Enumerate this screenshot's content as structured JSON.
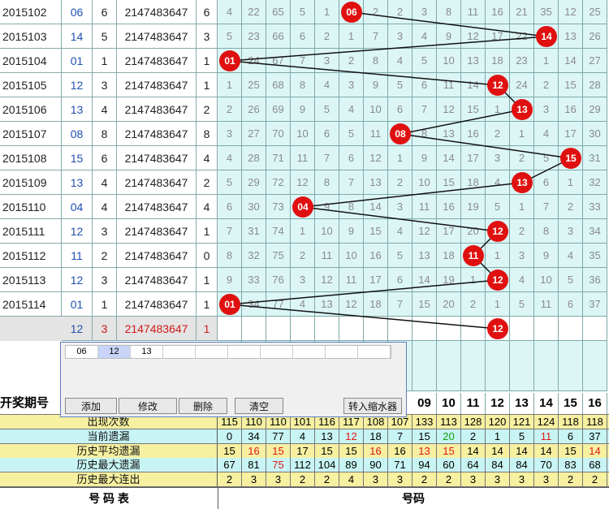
{
  "rows": [
    {
      "period": "2015102",
      "num": "06",
      "a": "6",
      "b": "2147483647",
      "c": "6",
      "grid": [
        "4",
        "22",
        "65",
        "5",
        "1",
        "06",
        "2",
        "2",
        "3",
        "8",
        "11",
        "16",
        "21",
        "35",
        "12",
        "25"
      ],
      "hit": 5
    },
    {
      "period": "2015103",
      "num": "14",
      "a": "5",
      "b": "2147483647",
      "c": "3",
      "grid": [
        "5",
        "23",
        "66",
        "6",
        "2",
        "1",
        "7",
        "3",
        "4",
        "9",
        "12",
        "17",
        "22",
        "14",
        "13",
        "26"
      ],
      "hit": 13
    },
    {
      "period": "2015104",
      "num": "01",
      "a": "1",
      "b": "2147483647",
      "c": "1",
      "grid": [
        "01",
        "24",
        "67",
        "7",
        "3",
        "2",
        "8",
        "4",
        "5",
        "10",
        "13",
        "18",
        "23",
        "1",
        "14",
        "27"
      ],
      "hit": 0
    },
    {
      "period": "2015105",
      "num": "12",
      "a": "3",
      "b": "2147483647",
      "c": "1",
      "grid": [
        "1",
        "25",
        "68",
        "8",
        "4",
        "3",
        "9",
        "5",
        "6",
        "11",
        "14",
        "12",
        "24",
        "2",
        "15",
        "28"
      ],
      "hit": 11
    },
    {
      "period": "2015106",
      "num": "13",
      "a": "4",
      "b": "2147483647",
      "c": "2",
      "grid": [
        "2",
        "26",
        "69",
        "9",
        "5",
        "4",
        "10",
        "6",
        "7",
        "12",
        "15",
        "1",
        "13",
        "3",
        "16",
        "29"
      ],
      "hit": 12
    },
    {
      "period": "2015107",
      "num": "08",
      "a": "8",
      "b": "2147483647",
      "c": "8",
      "grid": [
        "3",
        "27",
        "70",
        "10",
        "6",
        "5",
        "11",
        "08",
        "8",
        "13",
        "16",
        "2",
        "1",
        "4",
        "17",
        "30"
      ],
      "hit": 7
    },
    {
      "period": "2015108",
      "num": "15",
      "a": "6",
      "b": "2147483647",
      "c": "4",
      "grid": [
        "4",
        "28",
        "71",
        "11",
        "7",
        "6",
        "12",
        "1",
        "9",
        "14",
        "17",
        "3",
        "2",
        "5",
        "15",
        "31"
      ],
      "hit": 14
    },
    {
      "period": "2015109",
      "num": "13",
      "a": "4",
      "b": "2147483647",
      "c": "2",
      "grid": [
        "5",
        "29",
        "72",
        "12",
        "8",
        "7",
        "13",
        "2",
        "10",
        "15",
        "18",
        "4",
        "13",
        "6",
        "1",
        "32"
      ],
      "hit": 12
    },
    {
      "period": "2015110",
      "num": "04",
      "a": "4",
      "b": "2147483647",
      "c": "4",
      "grid": [
        "6",
        "30",
        "73",
        "04",
        "9",
        "8",
        "14",
        "3",
        "11",
        "16",
        "19",
        "5",
        "1",
        "7",
        "2",
        "33"
      ],
      "hit": 3
    },
    {
      "period": "2015111",
      "num": "12",
      "a": "3",
      "b": "2147483647",
      "c": "1",
      "grid": [
        "7",
        "31",
        "74",
        "1",
        "10",
        "9",
        "15",
        "4",
        "12",
        "17",
        "20",
        "12",
        "2",
        "8",
        "3",
        "34"
      ],
      "hit": 11
    },
    {
      "period": "2015112",
      "num": "11",
      "a": "2",
      "b": "2147483647",
      "c": "0",
      "grid": [
        "8",
        "32",
        "75",
        "2",
        "11",
        "10",
        "16",
        "5",
        "13",
        "18",
        "11",
        "1",
        "3",
        "9",
        "4",
        "35"
      ],
      "hit": 10
    },
    {
      "period": "2015113",
      "num": "12",
      "a": "3",
      "b": "2147483647",
      "c": "1",
      "grid": [
        "9",
        "33",
        "76",
        "3",
        "12",
        "11",
        "17",
        "6",
        "14",
        "19",
        "1",
        "12",
        "4",
        "10",
        "5",
        "36"
      ],
      "hit": 11
    },
    {
      "period": "2015114",
      "num": "01",
      "a": "1",
      "b": "2147483647",
      "c": "1",
      "grid": [
        "01",
        "34",
        "77",
        "4",
        "13",
        "12",
        "18",
        "7",
        "15",
        "20",
        "2",
        "1",
        "5",
        "11",
        "6",
        "37"
      ],
      "hit": 0
    }
  ],
  "predict": {
    "num": "12",
    "a": "3",
    "b": "2147483647",
    "c": "1",
    "ball": "12",
    "hit": 11
  },
  "dialog": {
    "chips": [
      "06",
      "12",
      "13"
    ],
    "add": "添加",
    "edit": "修改",
    "del": "删除",
    "clear": "清空",
    "shrink": "转入缩水器"
  },
  "header": {
    "period_label": "开奖期号",
    "numbers": [
      "09",
      "10",
      "11",
      "12",
      "13",
      "14",
      "15",
      "16"
    ]
  },
  "stats": [
    {
      "label": "出现次数",
      "bg": "#f6f0a0",
      "values": [
        "115",
        "110",
        "110",
        "101",
        "116",
        "117",
        "108",
        "107",
        "133",
        "113",
        "128",
        "120",
        "121",
        "124",
        "118",
        "118"
      ],
      "colors": {}
    },
    {
      "label": "当前遗漏",
      "bg": "#c8f4f4",
      "values": [
        "0",
        "34",
        "77",
        "4",
        "13",
        "12",
        "18",
        "7",
        "15",
        "20",
        "2",
        "1",
        "5",
        "11",
        "6",
        "37"
      ],
      "colors": {
        "5": "#e01818",
        "9": "#10a010",
        "13": "#e01818"
      }
    },
    {
      "label": "历史平均遗漏",
      "bg": "#f6f0a0",
      "values": [
        "15",
        "16",
        "15",
        "17",
        "15",
        "15",
        "16",
        "16",
        "13",
        "15",
        "14",
        "14",
        "14",
        "14",
        "15",
        "14"
      ],
      "colors": {
        "1": "#e01818",
        "2": "#e01818",
        "6": "#e01818",
        "8": "#e01818",
        "9": "#e01818",
        "15": "#e01818"
      }
    },
    {
      "label": "历史最大遗漏",
      "bg": "#c8f4f4",
      "values": [
        "67",
        "81",
        "75",
        "112",
        "104",
        "89",
        "90",
        "71",
        "94",
        "60",
        "64",
        "84",
        "84",
        "70",
        "83",
        "68"
      ],
      "colors": {
        "2": "#e01818"
      }
    },
    {
      "label": "历史最大连出",
      "bg": "#f6f0a0",
      "values": [
        "2",
        "3",
        "3",
        "2",
        "2",
        "4",
        "3",
        "3",
        "2",
        "2",
        "3",
        "3",
        "3",
        "3",
        "2",
        "2"
      ],
      "colors": {}
    }
  ],
  "footer": {
    "left": "号  码  表",
    "right": "号码"
  }
}
